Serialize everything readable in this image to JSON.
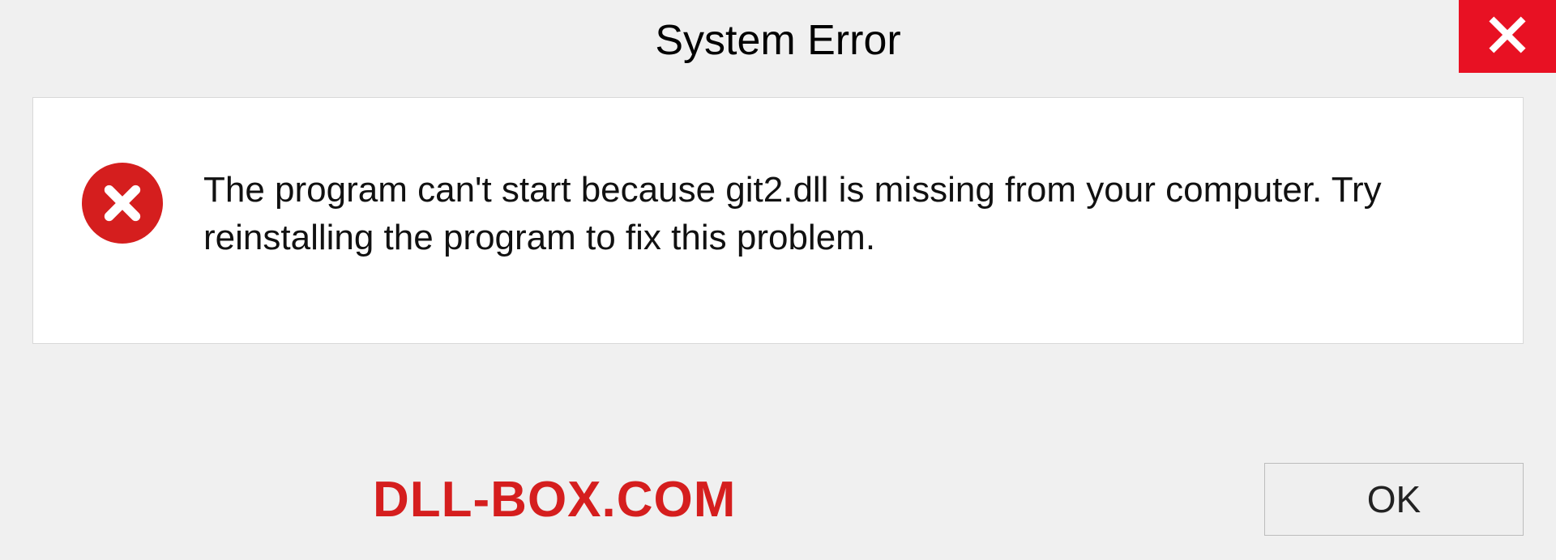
{
  "titlebar": {
    "title": "System Error"
  },
  "dialog": {
    "message": "The program can't start because git2.dll is missing from your computer. Try reinstalling the program to fix this problem."
  },
  "footer": {
    "watermark": "DLL-BOX.COM",
    "ok_label": "OK"
  }
}
